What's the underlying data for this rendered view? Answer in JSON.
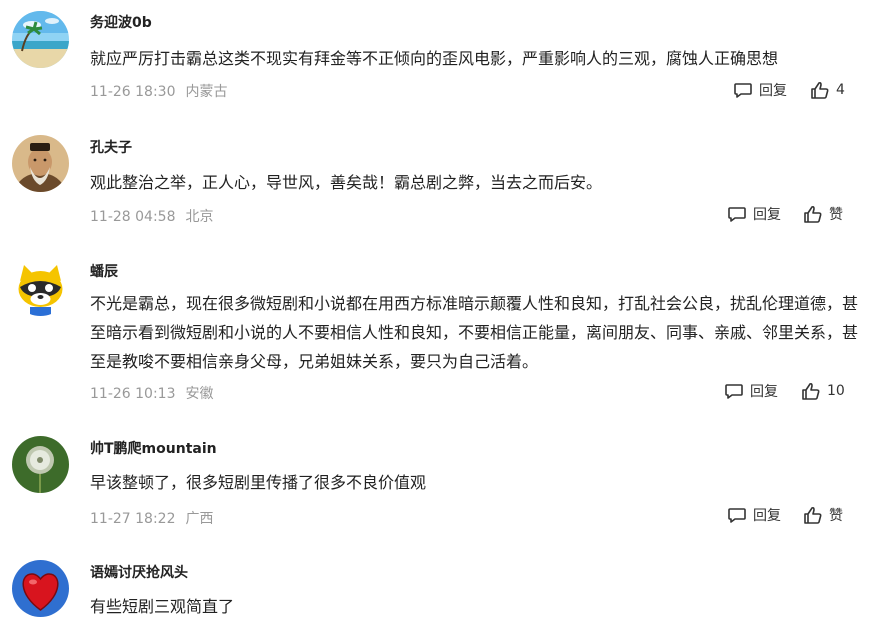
{
  "comments": [
    {
      "username": "务迎波0b",
      "avatar_icon": "beach-avatar-icon",
      "content": "就应严厉打击霸总这类不现实有拜金等不正倾向的歪风电影，严重影响人的三观，腐蚀人正确思想",
      "time": "11-26 18:30",
      "location": "内蒙古",
      "reply_label": "回复",
      "like_label": "4"
    },
    {
      "username": "孔夫子",
      "avatar_icon": "confucius-avatar-icon",
      "content": "观此整治之举，正人心，导世风，善矣哉！霸总剧之弊，当去之而后安。",
      "time": "11-28 04:58",
      "location": "北京",
      "reply_label": "回复",
      "like_label": "赞"
    },
    {
      "username": "蟠辰",
      "avatar_icon": "raccoon-avatar-icon",
      "content": "不光是霸总，现在很多微短剧和小说都在用西方标准暗示颠覆人性和良知，打乱社会公良，扰乱伦理道德，甚至暗示看到微短剧和小说的人不要相信人性和良知，不要相信正能量，离间朋友、同事、亲戚、邻里关系，甚至是教唆不要相信亲身父母，兄弟姐妹关系，要只为自己活着。",
      "time": "11-26 10:13",
      "location": "安徽",
      "reply_label": "回复",
      "like_label": "10"
    },
    {
      "username": "帅T鹏爬mountain",
      "avatar_icon": "dandelion-avatar-icon",
      "content": "早该整顿了，很多短剧里传播了很多不良价值观",
      "time": "11-27 18:22",
      "location": "广西",
      "reply_label": "回复",
      "like_label": "赞"
    },
    {
      "username": "语嫣讨厌抢风头",
      "avatar_icon": "heart-avatar-icon",
      "content": "有些短剧三观简直了"
    }
  ],
  "colors": {
    "text": "#222222",
    "meta": "#999999",
    "action": "#333333"
  }
}
